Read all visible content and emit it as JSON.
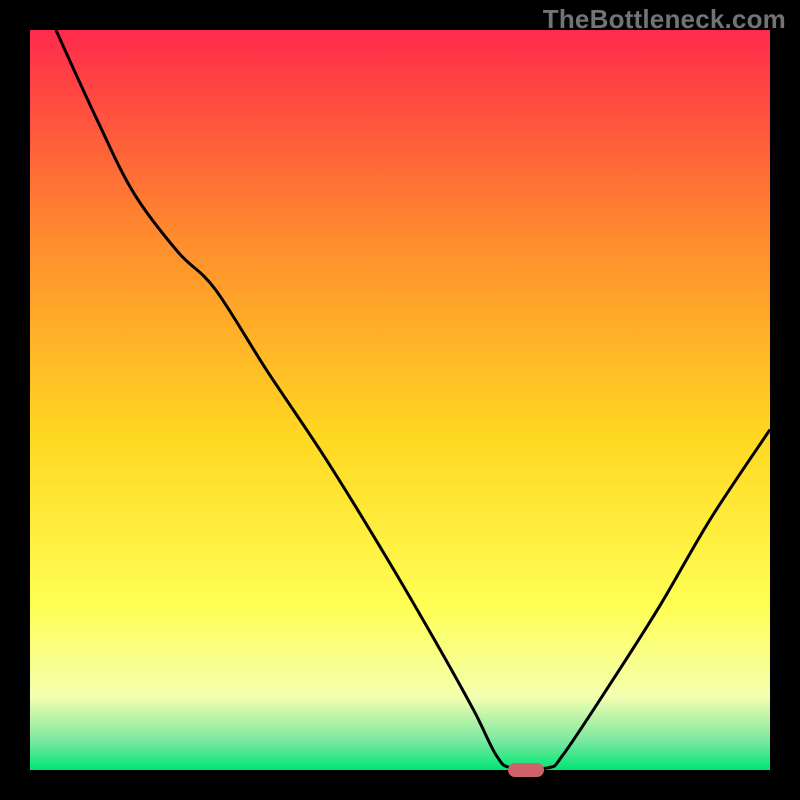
{
  "watermark": "TheBottleneck.com",
  "colors": {
    "bg": "#000000",
    "grad_top": "#ff2a4b",
    "grad_mid1": "#ff8b2d",
    "grad_mid2": "#ffd822",
    "grad_mid3": "#ffff55",
    "grad_low1": "#f4ffb0",
    "grad_low2": "#7de8a0",
    "grad_bottom": "#00e676",
    "curve": "#000000",
    "marker": "#ce6169",
    "watermark": "#737373"
  },
  "chart_data": {
    "type": "line",
    "title": "",
    "xlabel": "",
    "ylabel": "",
    "xlim": [
      0,
      100
    ],
    "ylim": [
      0,
      100
    ],
    "marker_at": {
      "x": 67,
      "y": 0
    },
    "series": [
      {
        "name": "bottleneck-curve",
        "points": [
          {
            "x": 3.5,
            "y": 100
          },
          {
            "x": 9,
            "y": 88
          },
          {
            "x": 14,
            "y": 78
          },
          {
            "x": 20,
            "y": 70
          },
          {
            "x": 25,
            "y": 65
          },
          {
            "x": 32,
            "y": 54
          },
          {
            "x": 40,
            "y": 42
          },
          {
            "x": 48,
            "y": 29
          },
          {
            "x": 55,
            "y": 17
          },
          {
            "x": 60,
            "y": 8
          },
          {
            "x": 63,
            "y": 2
          },
          {
            "x": 65,
            "y": 0.3
          },
          {
            "x": 70,
            "y": 0.3
          },
          {
            "x": 72,
            "y": 2
          },
          {
            "x": 78,
            "y": 11
          },
          {
            "x": 85,
            "y": 22
          },
          {
            "x": 92,
            "y": 34
          },
          {
            "x": 100,
            "y": 46
          }
        ]
      }
    ]
  }
}
